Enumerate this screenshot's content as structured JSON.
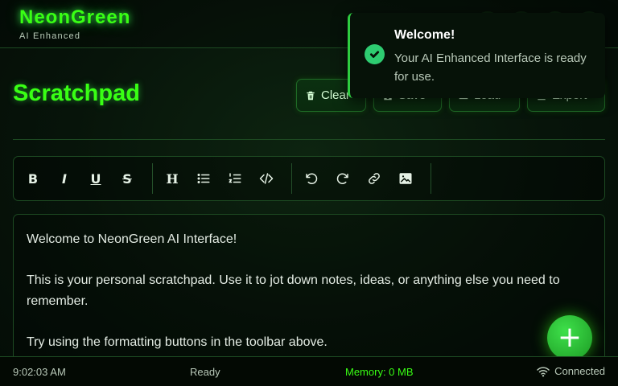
{
  "header": {
    "title": "NeonGreen",
    "subtitle": "AI Enhanced",
    "icons": [
      "expand-icon",
      "theme-icon",
      "settings-icon",
      "menu-icon"
    ]
  },
  "page": {
    "title": "Scratchpad",
    "actions": {
      "clear_label": "Clear",
      "save_label": "Save",
      "load_label": "Load",
      "export_label": "Export"
    }
  },
  "toolbar": {
    "bold": "B",
    "italic": "I",
    "underline": "U",
    "strikethrough": "S",
    "heading": "H",
    "icons": [
      "bold-icon",
      "italic-icon",
      "underline-icon",
      "strikethrough-icon",
      "heading-icon",
      "bullet-list-icon",
      "numbered-list-icon",
      "code-icon",
      "undo-icon",
      "redo-icon",
      "link-icon",
      "image-icon"
    ]
  },
  "editor": {
    "paragraphs": [
      "Welcome to NeonGreen AI Interface!",
      "This is your personal scratchpad. Use it to jot down notes, ideas, or anything else you need to remember.",
      "Try using the formatting buttons in the toolbar above."
    ]
  },
  "statusbar": {
    "time": "9:02:03 AM",
    "status": "Ready",
    "memory": "Memory: 0 MB",
    "connection": "Connected"
  },
  "fab": {
    "label": "+"
  },
  "toast": {
    "title": "Welcome!",
    "message": "Your AI Enhanced Interface is ready for use."
  },
  "colors": {
    "accent": "#39ff14",
    "success": "#2ecc71",
    "background": "#07140a"
  }
}
